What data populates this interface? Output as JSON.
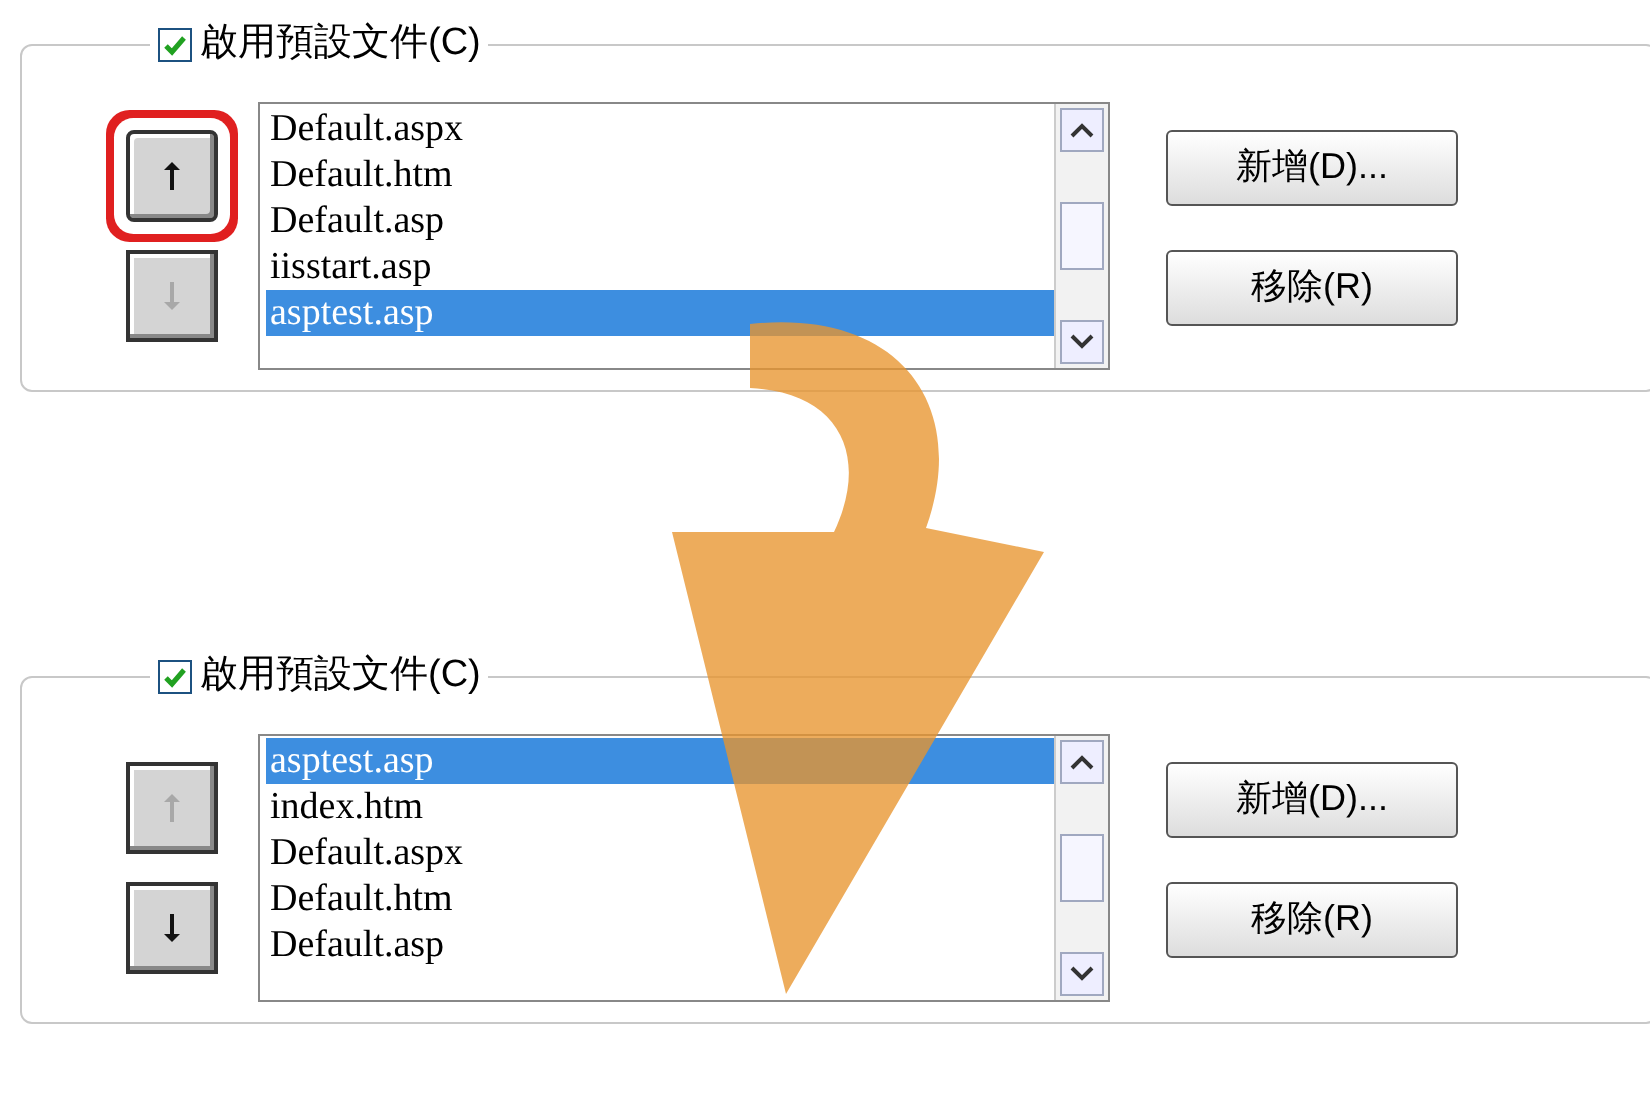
{
  "panels": [
    {
      "checkbox": {
        "label": "啟用預設文件(C)",
        "checked": true
      },
      "move_up": {
        "disabled": false,
        "highlighted": true
      },
      "move_down": {
        "disabled": true,
        "highlighted": false
      },
      "items": [
        {
          "label": "Default.aspx",
          "selected": false
        },
        {
          "label": "Default.htm",
          "selected": false
        },
        {
          "label": "Default.asp",
          "selected": false
        },
        {
          "label": "iisstart.asp",
          "selected": false
        },
        {
          "label": "asptest.asp",
          "selected": true
        }
      ],
      "buttons": [
        "新增(D)...",
        "移除(R)"
      ]
    },
    {
      "checkbox": {
        "label": "啟用預設文件(C)",
        "checked": true
      },
      "move_up": {
        "disabled": true,
        "highlighted": false
      },
      "move_down": {
        "disabled": false,
        "highlighted": false
      },
      "items": [
        {
          "label": "asptest.asp",
          "selected": true
        },
        {
          "label": "index.htm",
          "selected": false
        },
        {
          "label": "Default.aspx",
          "selected": false
        },
        {
          "label": "Default.htm",
          "selected": false
        },
        {
          "label": "Default.asp",
          "selected": false
        }
      ],
      "buttons": [
        "新增(D)...",
        "移除(R)"
      ]
    }
  ]
}
